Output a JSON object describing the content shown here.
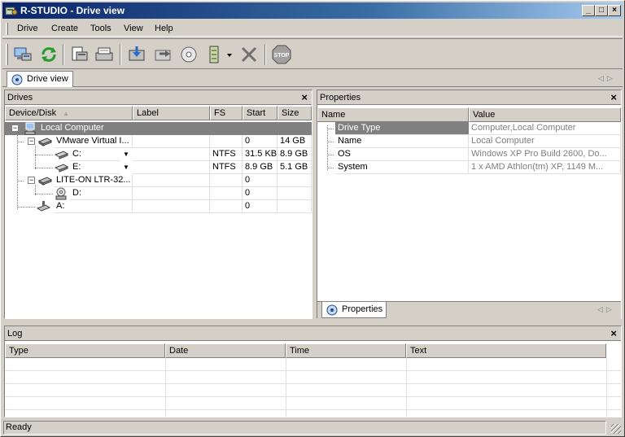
{
  "window": {
    "title": "R-STUDIO - Drive view"
  },
  "menu": [
    "Drive",
    "Create",
    "Tools",
    "View",
    "Help"
  ],
  "toolbar": {
    "icons": [
      "connect-computer-icon",
      "refresh-icon",
      "open-image-icon",
      "scan-icon",
      "recover-icon",
      "recover-marked-icon",
      "create-image-icon",
      "region-icon",
      "remove-icon",
      "stop-icon"
    ]
  },
  "view_tab": {
    "label": "Drive view"
  },
  "drives": {
    "title": "Drives",
    "columns": [
      "Device/Disk",
      "Label",
      "FS",
      "Start",
      "Size"
    ],
    "rows": [
      {
        "device": "Local Computer",
        "label": "",
        "fs": "",
        "start": "",
        "size": ""
      },
      {
        "device": "VMware Virtual I...",
        "label": "",
        "fs": "",
        "start": "0",
        "size": "14 GB"
      },
      {
        "device": "C:",
        "label": "",
        "fs": "NTFS",
        "start": "31.5 KB",
        "size": "8.9 GB"
      },
      {
        "device": "E:",
        "label": "",
        "fs": "NTFS",
        "start": "8.9 GB",
        "size": "5.1 GB"
      },
      {
        "device": "LITE-ON LTR-32...",
        "label": "",
        "fs": "",
        "start": "0",
        "size": ""
      },
      {
        "device": "D:",
        "label": "",
        "fs": "",
        "start": "0",
        "size": ""
      },
      {
        "device": "A:",
        "label": "",
        "fs": "",
        "start": "0",
        "size": ""
      }
    ]
  },
  "properties": {
    "title": "Properties",
    "columns": [
      "Name",
      "Value"
    ],
    "rows": [
      {
        "name": "Drive Type",
        "value": "Computer,Local Computer"
      },
      {
        "name": "Name",
        "value": "Local Computer"
      },
      {
        "name": "OS",
        "value": "Windows XP Pro Build 2600, Do..."
      },
      {
        "name": "System",
        "value": "1 x AMD Athlon(tm) XP, 1149 M..."
      }
    ],
    "tab_label": "Properties"
  },
  "log": {
    "title": "Log",
    "columns": [
      "Type",
      "Date",
      "Time",
      "Text"
    ]
  },
  "status": {
    "text": "Ready"
  }
}
